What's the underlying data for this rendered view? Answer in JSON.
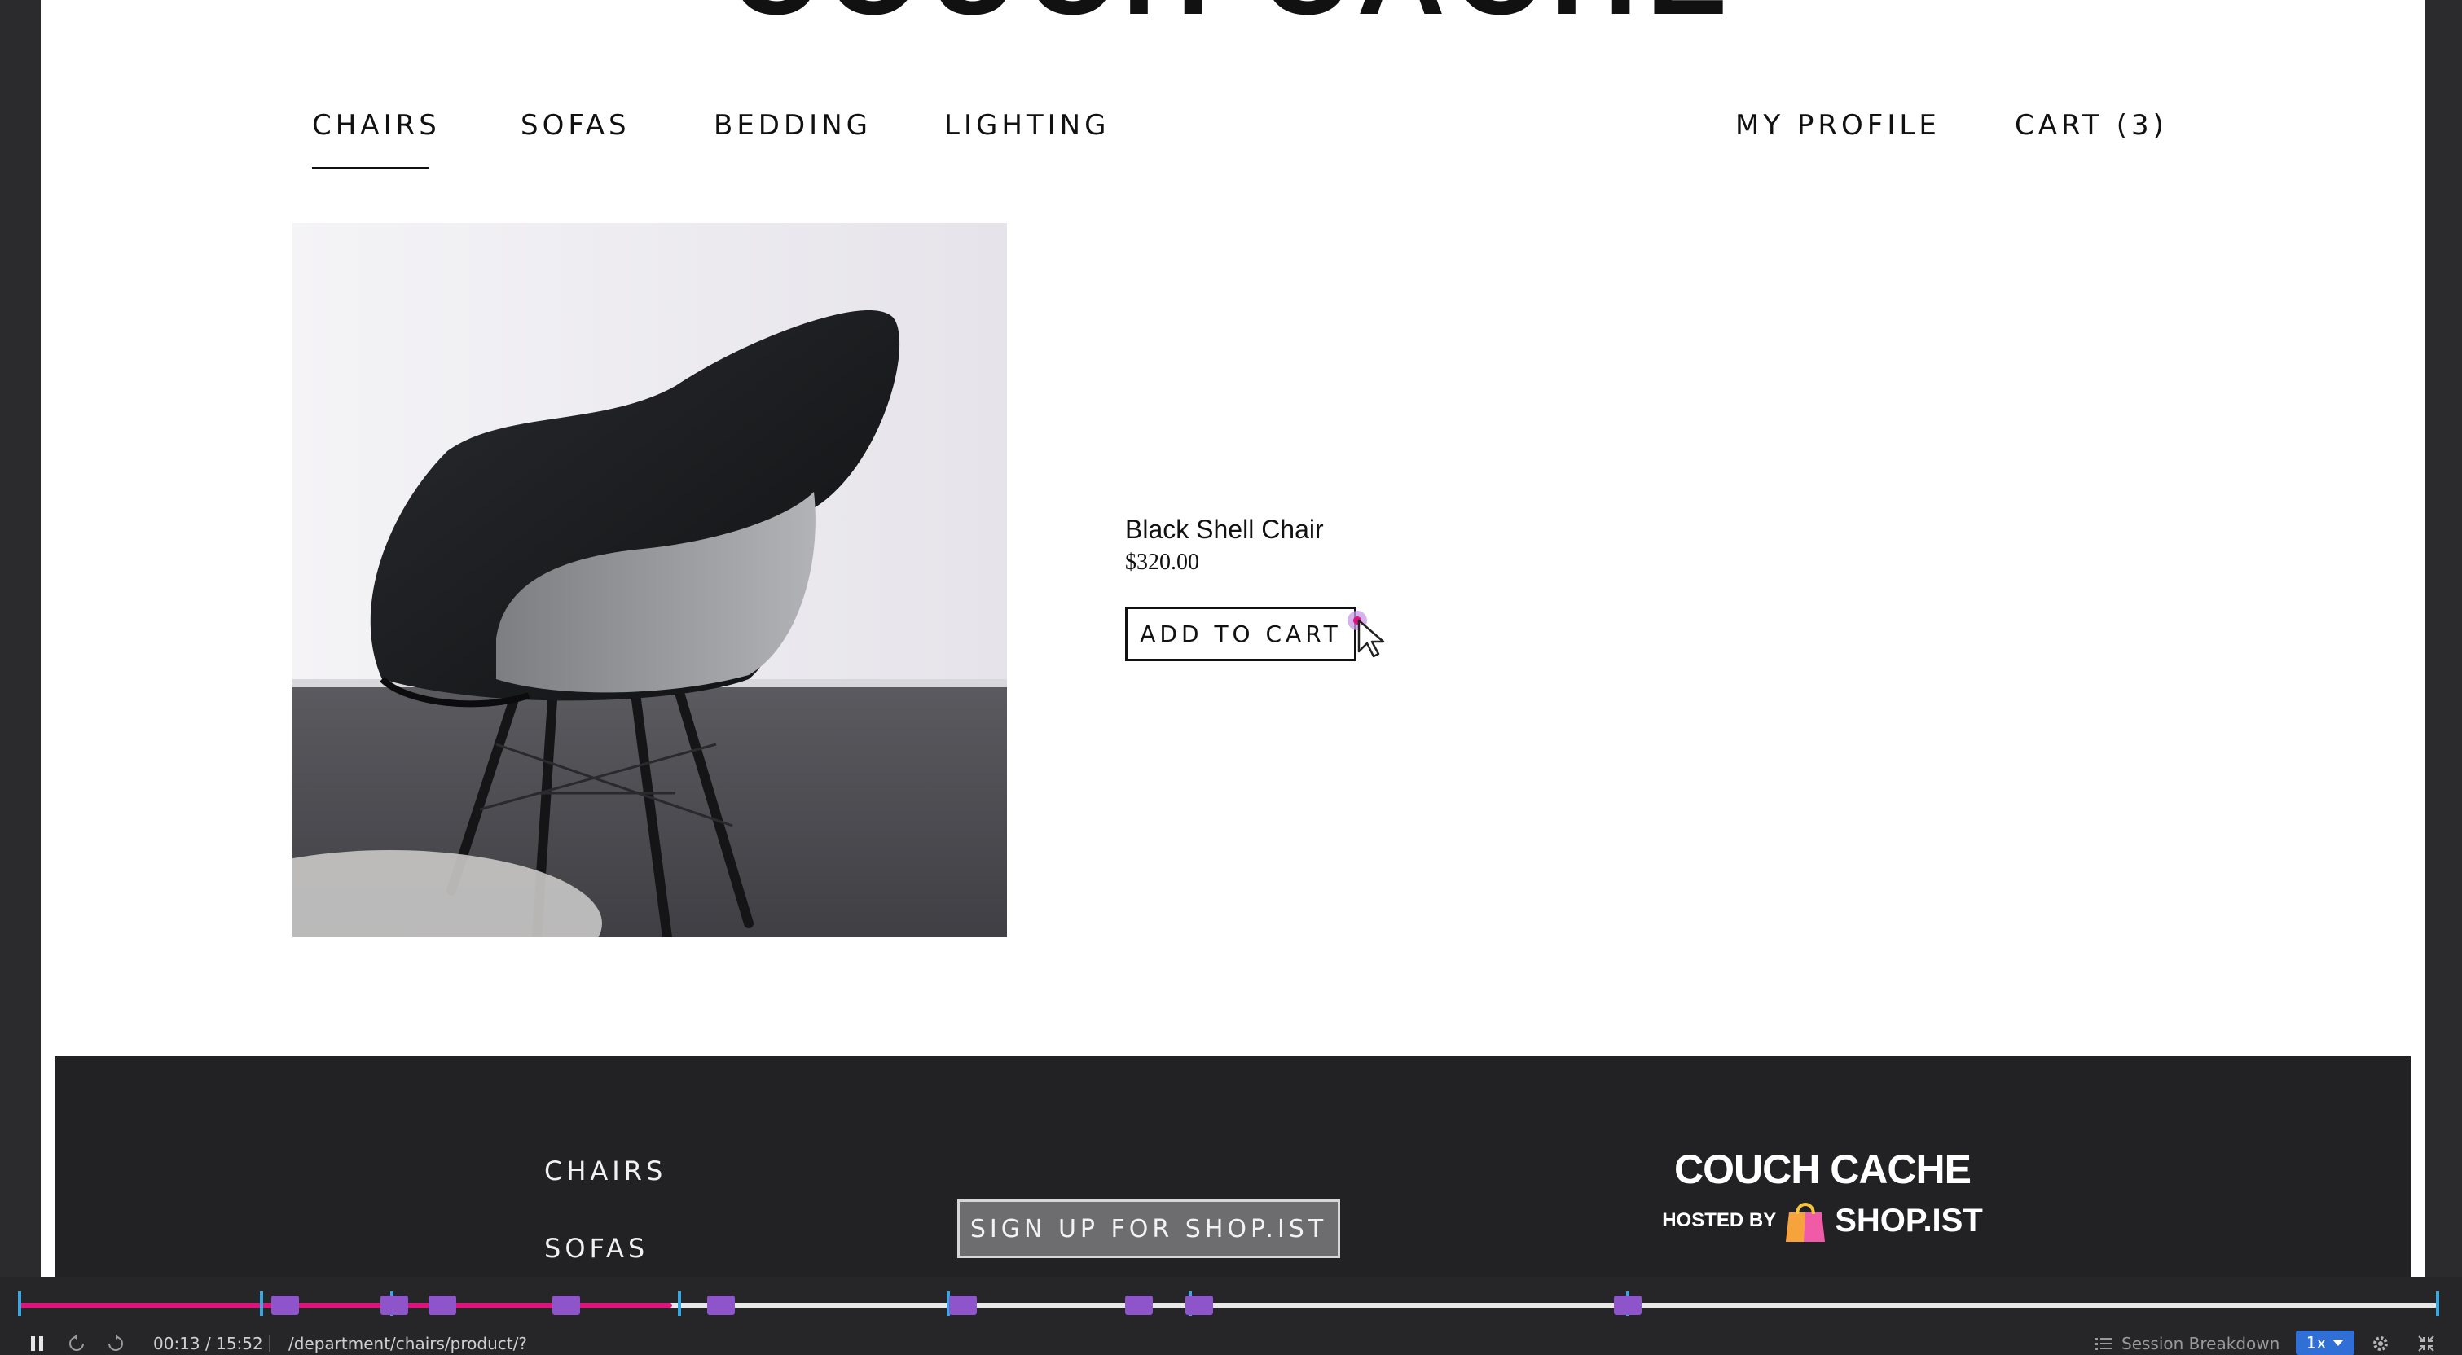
{
  "site": {
    "brand": "COUCH CACHE",
    "nav_left": [
      "CHAIRS",
      "SOFAS",
      "BEDDING",
      "LIGHTING"
    ],
    "nav_right": [
      "MY PROFILE",
      "CART (3)"
    ]
  },
  "product": {
    "name": "Black Shell Chair",
    "price": "$320.00",
    "add_to_cart": "ADD TO CART"
  },
  "footer": {
    "links": [
      "CHAIRS",
      "SOFAS"
    ],
    "signup": "SIGN UP FOR SHOP.IST",
    "brand_name": "COUCH CACHE",
    "hosted_by": "HOSTED BY",
    "shop_name": "SHOP.IST"
  },
  "replay": {
    "progress": 0.27,
    "time": "00:13 / 15:52",
    "url": "/department/chairs/product/?",
    "session_breakdown": "Session Breakdown",
    "speed": "1x",
    "event_markers": [
      0.11,
      0.155,
      0.175,
      0.226,
      0.29,
      0.39,
      0.463,
      0.488,
      0.665
    ],
    "tick_markers": [
      0.0,
      0.1,
      0.154,
      0.273,
      0.384,
      0.484,
      0.665,
      1.0
    ],
    "colors": {
      "progress": "#e0137e",
      "event": "#8e54c9",
      "tick": "#3aa8e0",
      "speed_badge": "#2f6fd6"
    }
  }
}
